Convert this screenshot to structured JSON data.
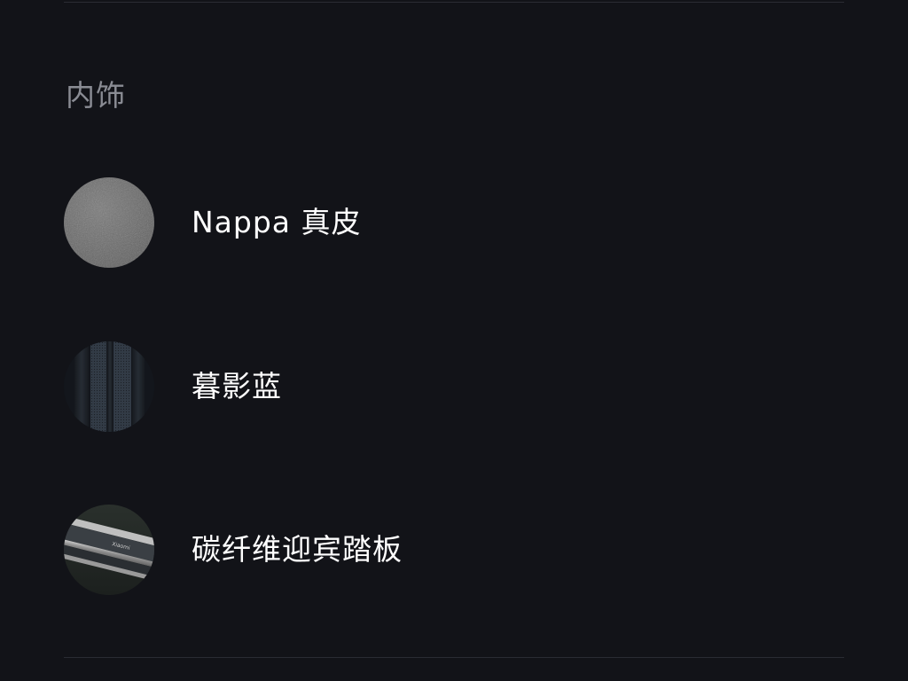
{
  "section": {
    "title": "内饰"
  },
  "options": [
    {
      "label": "Nappa 真皮",
      "swatch_icon": "nappa-leather-swatch",
      "swatch_color": "#6f6f6f"
    },
    {
      "label": "暮影蓝",
      "swatch_icon": "dusk-blue-swatch",
      "swatch_color": "#2b333d"
    },
    {
      "label": "碳纤维迎宾踏板",
      "swatch_icon": "carbon-sill-plate-swatch",
      "swatch_color": "#9a9a9a",
      "swatch_text": "Xiaomi"
    }
  ],
  "colors": {
    "background": "#121318",
    "divider": "#2a2c33",
    "title": "#8a8c94",
    "label": "#ffffff"
  }
}
